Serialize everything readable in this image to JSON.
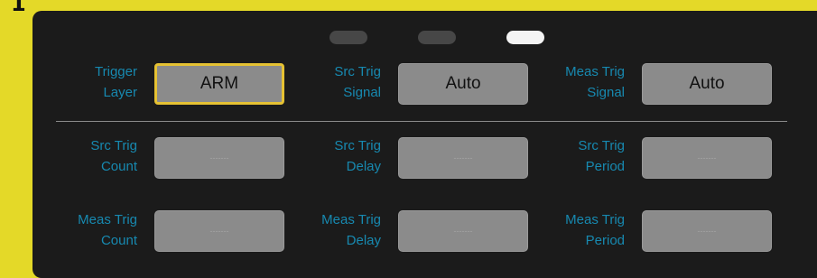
{
  "tab_number": "1",
  "pager": {
    "count": 3,
    "active_index": 3
  },
  "rows": [
    {
      "cells": [
        {
          "label_line1": "Trigger",
          "label_line2": "Layer",
          "value": "ARM"
        },
        {
          "label_line1": "Src Trig",
          "label_line2": "Signal",
          "value": "Auto"
        },
        {
          "label_line1": "Meas Trig",
          "label_line2": "Signal",
          "value": "Auto"
        }
      ]
    },
    {
      "cells": [
        {
          "label_line1": "Src Trig",
          "label_line2": "Count",
          "value": "-------"
        },
        {
          "label_line1": "Src Trig",
          "label_line2": "Delay",
          "value": "-------"
        },
        {
          "label_line1": "Src Trig",
          "label_line2": "Period",
          "value": "-------"
        }
      ]
    },
    {
      "cells": [
        {
          "label_line1": "Meas Trig",
          "label_line2": "Count",
          "value": "-------"
        },
        {
          "label_line1": "Meas Trig",
          "label_line2": "Delay",
          "value": "-------"
        },
        {
          "label_line1": "Meas Trig",
          "label_line2": "Period",
          "value": "-------"
        }
      ]
    }
  ],
  "colors": {
    "frame": "#e4d928",
    "panel": "#1b1b1b",
    "label": "#1789b0",
    "field": "#8b8b8b",
    "active_border": "#e6c233"
  }
}
